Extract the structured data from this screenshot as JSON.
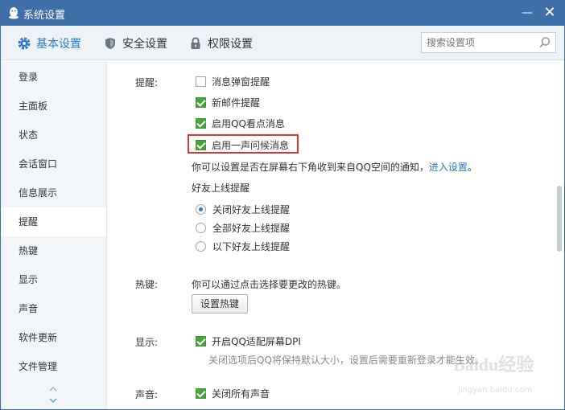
{
  "window": {
    "title": "系统设置"
  },
  "tabs": [
    {
      "label": "基本设置",
      "icon": "gear-icon",
      "active": true
    },
    {
      "label": "安全设置",
      "icon": "shield-icon",
      "active": false
    },
    {
      "label": "权限设置",
      "icon": "lock-icon",
      "active": false
    }
  ],
  "search": {
    "placeholder": "搜索设置项"
  },
  "sidebar": {
    "items": [
      {
        "label": "登录"
      },
      {
        "label": "主面板"
      },
      {
        "label": "状态"
      },
      {
        "label": "会话窗口"
      },
      {
        "label": "信息展示"
      },
      {
        "label": "提醒",
        "active": true
      },
      {
        "label": "热键"
      },
      {
        "label": "显示"
      },
      {
        "label": "声音"
      },
      {
        "label": "软件更新"
      },
      {
        "label": "文件管理"
      }
    ]
  },
  "reminder": {
    "label": "提醒:",
    "options": [
      {
        "label": "消息弹窗提醒",
        "checked": false
      },
      {
        "label": "新邮件提醒",
        "checked": true
      },
      {
        "label": "启用QQ看点消息",
        "checked": true
      },
      {
        "label": "启用一声问候消息",
        "checked": true
      }
    ],
    "note": "你可以设置是否在屏幕右下角收到来自QQ空间的通知，",
    "note_link": "进入设置",
    "note_end": "。",
    "friend_online_title": "好友上线提醒",
    "friend_online_options": [
      {
        "label": "关闭好友上线提醒",
        "selected": true
      },
      {
        "label": "全部好友上线提醒",
        "selected": false
      },
      {
        "label": "以下好友上线提醒",
        "selected": false
      }
    ]
  },
  "hotkey": {
    "label": "热键:",
    "note": "你可以通过点击选择要更改的热键。",
    "button": "设置热键"
  },
  "display": {
    "label": "显示:",
    "option": "开启QQ适配屏幕DPI",
    "checked": true,
    "hint": "关闭选项后QQ将保持默认大小，设置后需要重新登录才能生效。"
  },
  "sound": {
    "label": "声音:",
    "option": "关闭所有声音",
    "checked": true
  },
  "watermark": {
    "main": "Baidu经验",
    "sub": "jingyan.baidu.com"
  },
  "colors": {
    "titlebar": "#3f6fa6",
    "accent": "#2b79c8",
    "check": "#45a73b",
    "highlight": "#e0322e"
  }
}
